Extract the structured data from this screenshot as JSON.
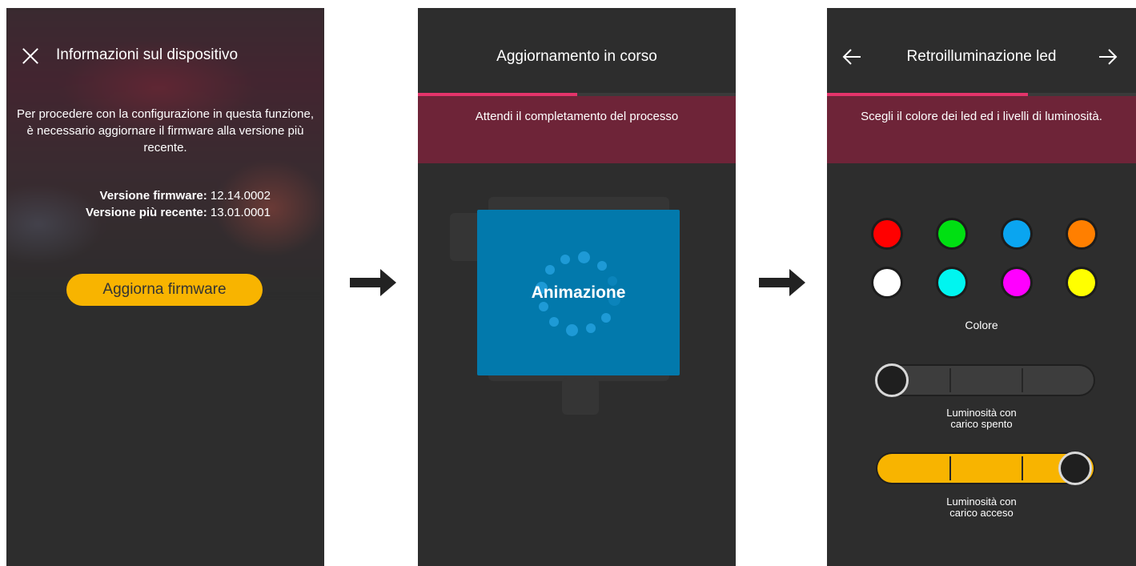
{
  "screen1": {
    "title": "Informazioni sul dispositivo",
    "message": "Per procedere con la configurazione in questa funzione, è necessario aggiornare il firmware alla versione più recente.",
    "firmware_label": "Versione firmware:",
    "firmware_value": "12.14.0002",
    "latest_label": "Versione più recente:",
    "latest_value": "13.01.0001",
    "update_button": "Aggiorna firmware",
    "close_icon": "close-icon"
  },
  "screen2": {
    "title": "Aggiornamento in corso",
    "subtitle": "Attendi il completamento del processo",
    "animation_label": "Animazione",
    "progress": 0.5
  },
  "screen3": {
    "title": "Retroilluminazione led",
    "subtitle": "Scegli il colore dei led ed i livelli di luminosità.",
    "back_icon": "arrow-left-icon",
    "forward_icon": "arrow-right-icon",
    "progress": 0.65,
    "colors": [
      "#ff0000",
      "#00e012",
      "#0aa5f0",
      "#ff7f00",
      "#ffffff",
      "#00f5f0",
      "#ff00ff",
      "#ffff00"
    ],
    "color_label": "Colore",
    "slider_off": {
      "label_line1": "Luminosità con",
      "label_line2": "carico spento",
      "level": 0
    },
    "slider_on": {
      "label_line1": "Luminosità con",
      "label_line2": "carico acceso",
      "level": 1
    }
  },
  "accent": {
    "header": "#6e2438",
    "progress": "#e4346a",
    "button": "#f8b400",
    "animation": "#0279ac"
  }
}
